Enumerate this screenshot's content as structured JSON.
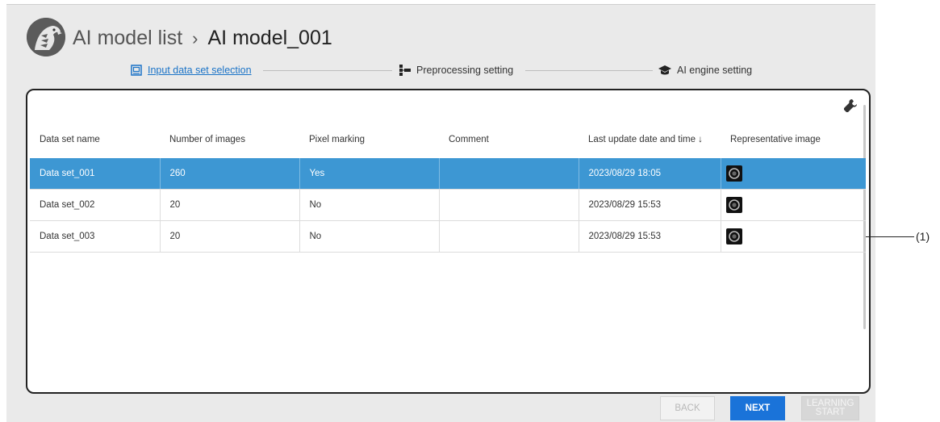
{
  "header": {
    "breadcrumb_root": "AI model list",
    "breadcrumb_separator": "›",
    "breadcrumb_current": "AI model_001",
    "logo_icon": "falcon-logo-icon"
  },
  "steps": [
    {
      "label": "Input data set selection",
      "icon": "image-icon",
      "active": true
    },
    {
      "label": "Preprocessing setting",
      "icon": "flow-icon",
      "active": false
    },
    {
      "label": "AI engine setting",
      "icon": "graduation-cap-icon",
      "active": false
    }
  ],
  "table": {
    "tool_icon": "wrench-icon",
    "columns": [
      "Data set name",
      "Number of images",
      "Pixel marking",
      "Comment",
      "Last update date and time ↓",
      "Representative image"
    ],
    "rows": [
      {
        "name": "Data set_001",
        "images": "260",
        "pixel_marking": "Yes",
        "comment": "",
        "updated": "2023/08/29 18:05",
        "selected": true
      },
      {
        "name": "Data set_002",
        "images": "20",
        "pixel_marking": "No",
        "comment": "",
        "updated": "2023/08/29 15:53",
        "selected": false
      },
      {
        "name": "Data set_003",
        "images": "20",
        "pixel_marking": "No",
        "comment": "",
        "updated": "2023/08/29 15:53",
        "selected": false
      }
    ],
    "selected_color": "#3d97d3"
  },
  "buttons": {
    "back": "BACK",
    "next": "NEXT",
    "learning_line1": "LEARNING",
    "learning_line2": "START",
    "next_color": "#1a73d9"
  },
  "callout": {
    "label": "(1)"
  }
}
